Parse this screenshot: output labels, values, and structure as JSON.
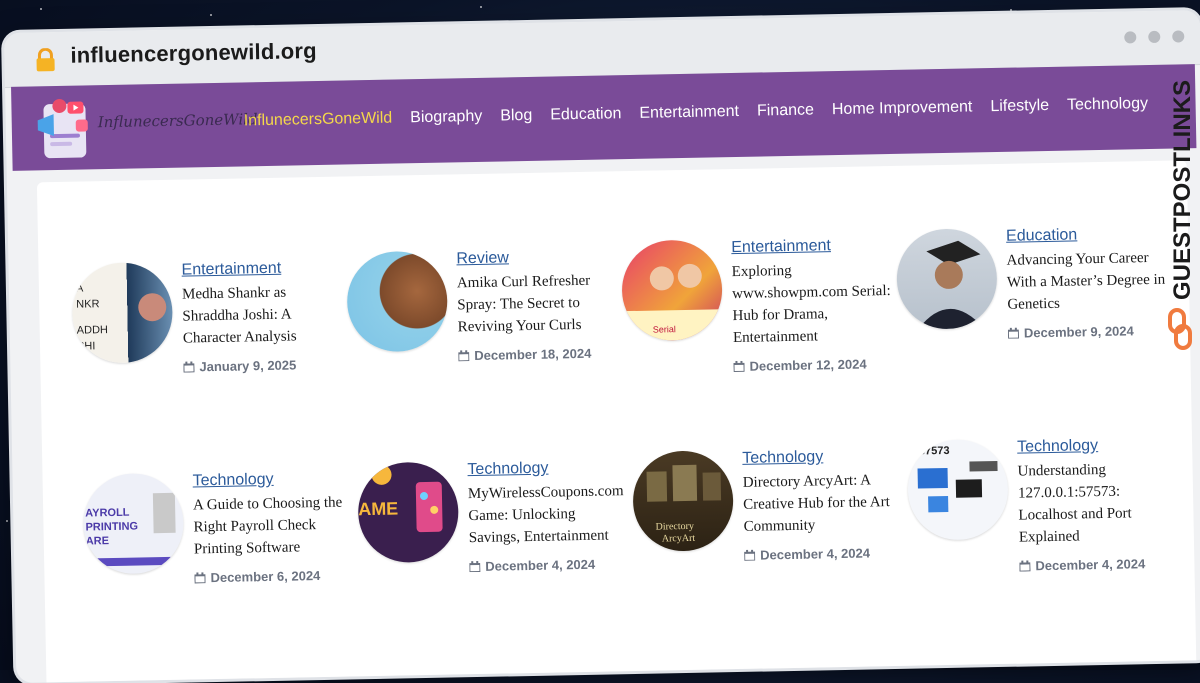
{
  "browser": {
    "url": "influencergonewild.org"
  },
  "nav": {
    "logo_text": "InflunecersGoneWild",
    "items": [
      {
        "label": "InflunecersGoneWild",
        "active": true
      },
      {
        "label": "Biography",
        "active": false
      },
      {
        "label": "Blog",
        "active": false
      },
      {
        "label": "Education",
        "active": false
      },
      {
        "label": "Entertainment",
        "active": false
      },
      {
        "label": "Finance",
        "active": false
      },
      {
        "label": "Home Improvement",
        "active": false
      },
      {
        "label": "Lifestyle",
        "active": false
      },
      {
        "label": "Technology",
        "active": false
      }
    ]
  },
  "posts": [
    {
      "category": "Entertainment",
      "title": "Medha Shankr as Shraddha Joshi: A Character Analysis",
      "date": "January 9, 2025"
    },
    {
      "category": "Review",
      "title": "Amika Curl Refresher Spray: The Secret to Reviving Your Curls",
      "date": "December 18, 2024"
    },
    {
      "category": "Entertainment",
      "title": "Exploring www.showpm.com Serial: Hub for Drama, Entertainment",
      "date": "December 12, 2024"
    },
    {
      "category": "Education",
      "title": "Advancing Your Career With a Master’s Degree in Genetics",
      "date": "December 9, 2024"
    },
    {
      "category": "Technology",
      "title": "A Guide to Choosing the Right Payroll Check Printing Software",
      "date": "December 6, 2024"
    },
    {
      "category": "Technology",
      "title": "MyWirelessCoupons.com Game: Unlocking Savings, Entertainment",
      "date": "December 4, 2024"
    },
    {
      "category": "Technology",
      "title": "Directory ArcyArt: A Creative Hub for the Art Community",
      "date": "December 4, 2024"
    },
    {
      "category": "Technology",
      "title": "Understanding 127.0.0.1:57573: Localhost and Port Explained",
      "date": "December 4, 2024"
    }
  ],
  "side_brand": "GUESTPOSTLINKS",
  "colors": {
    "nav_bg": "#7a4b98",
    "active_link": "#f5d84a",
    "category_link": "#2b5a9a",
    "brand_orange": "#f07b3f"
  }
}
